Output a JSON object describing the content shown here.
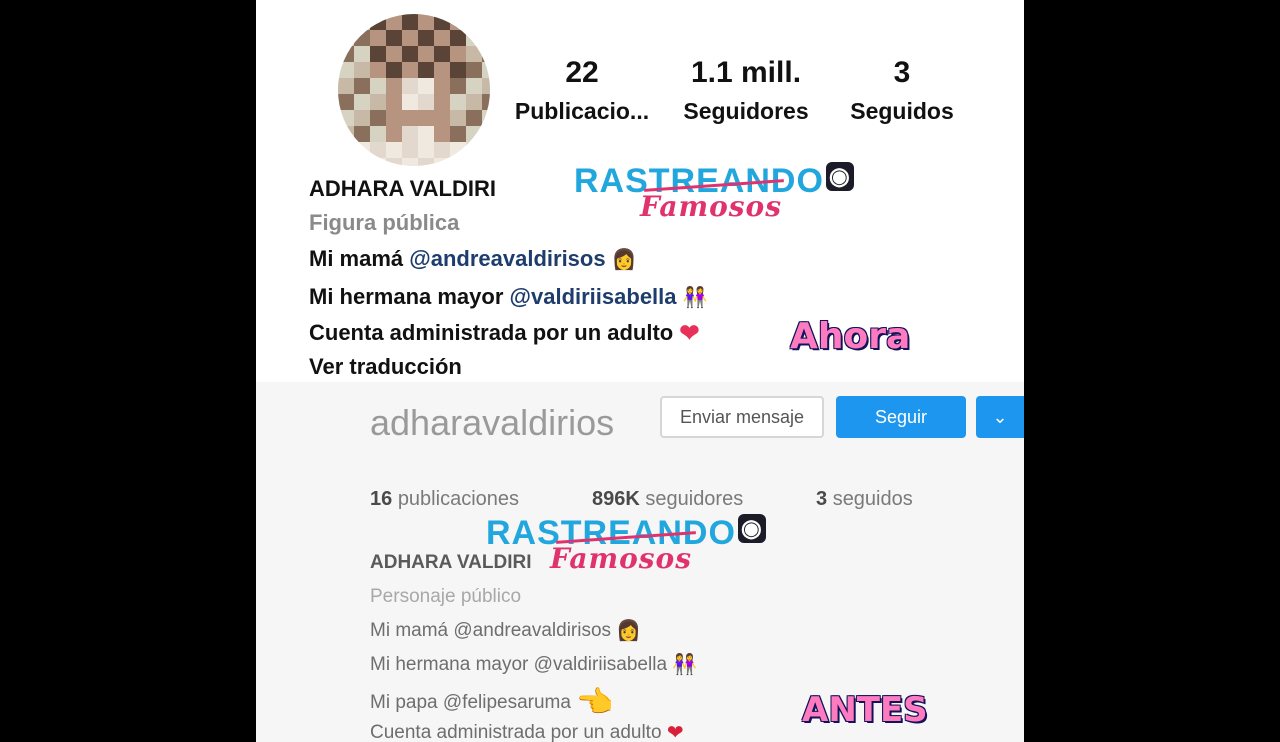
{
  "ahora": {
    "stats": [
      {
        "num": "22",
        "label": "Publicacio..."
      },
      {
        "num": "1.1 mill.",
        "label": "Seguidores"
      },
      {
        "num": "3",
        "label": "Seguidos"
      }
    ],
    "name": "ADHARA VALDIRI",
    "category": "Figura pública",
    "bio1_prefix": "Mi mamá",
    "bio1_link": "@andreavaldirisos",
    "bio2_prefix": "Mi hermana mayor",
    "bio2_link": "@valdiriisabella",
    "bio3": "Cuenta administrada por un adulto",
    "translate": "Ver traducción",
    "emoji_mom": "👩",
    "emoji_sisters": "👭",
    "emoji_heart": "❤"
  },
  "antes": {
    "username": "adharavaldirios",
    "message_button": "Enviar mensaje",
    "follow_button": "Seguir",
    "dropdown_icon": "chevron-down-icon",
    "stats": [
      {
        "num": "16",
        "label": "publicaciones"
      },
      {
        "num": "896K",
        "label": "seguidores"
      },
      {
        "num": "3",
        "label": "seguidos"
      }
    ],
    "name": "ADHARA VALDIRI",
    "category": "Personaje público",
    "bio1": "Mi mamá @andreavaldirisos",
    "bio2": "Mi hermana mayor @valdiriisabella",
    "bio3": "Mi papa @felipesaruma",
    "bio4": "Cuenta administrada por un adulto",
    "emoji_mom": "👩",
    "emoji_sisters": "👭",
    "emoji_point": "👈",
    "emoji_heart": "❤"
  },
  "watermark": {
    "main": "RASTREANDO",
    "script": "Famosos",
    "camera_icon": "camera-icon"
  },
  "labels": {
    "ahora": "Ahora",
    "antes": "ANTES"
  },
  "colors": {
    "watermark_blue": "#22a6de",
    "watermark_pink": "#e0336e",
    "tag_pink": "#ff7bbf",
    "follow_blue": "#1d96f0",
    "link_blue": "#1e3d6d"
  }
}
